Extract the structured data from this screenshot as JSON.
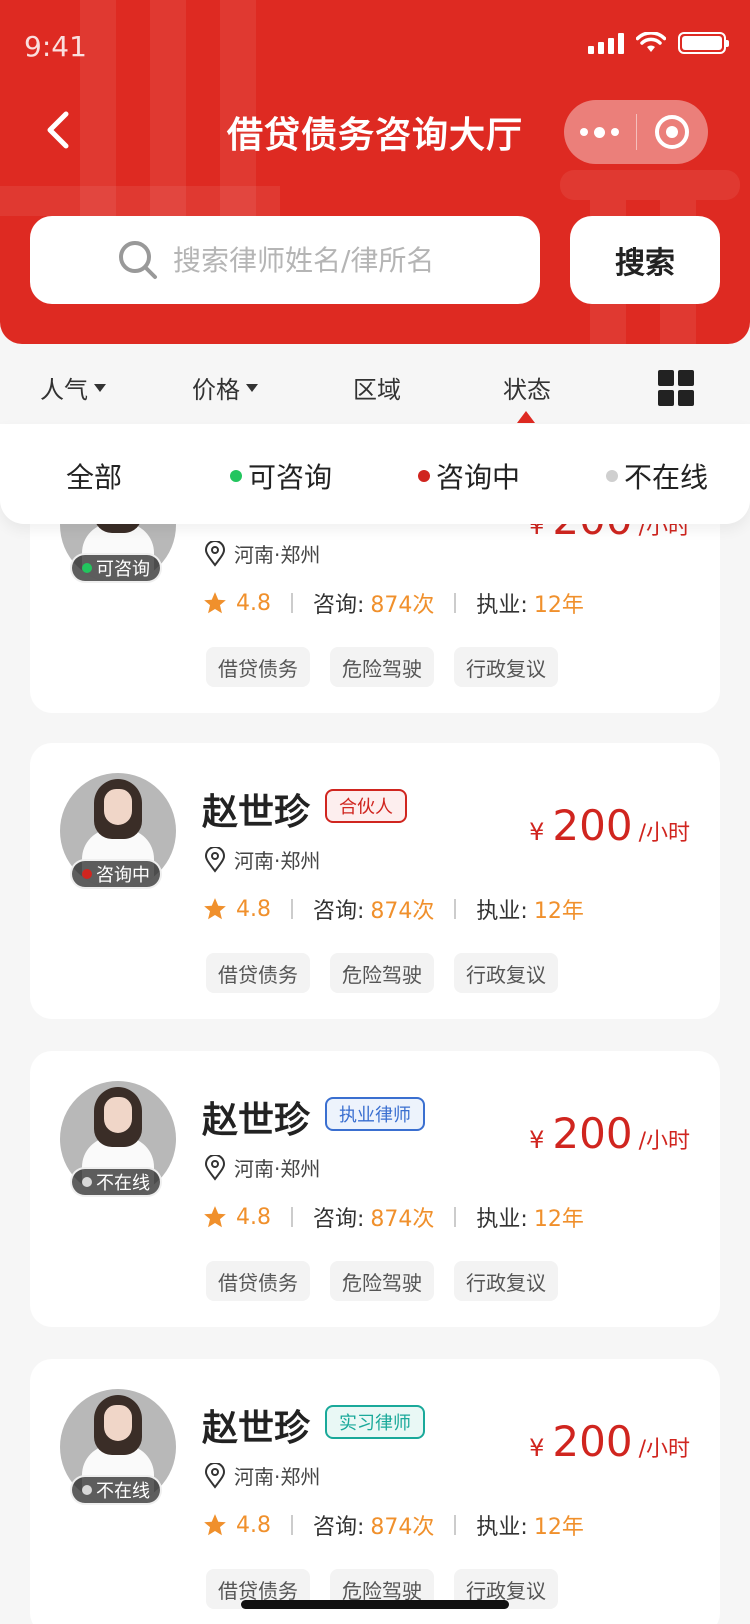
{
  "status_bar": {
    "time": "9:41"
  },
  "header": {
    "title": "借贷债务咨询大厅"
  },
  "search": {
    "placeholder": "搜索律师姓名/律所名",
    "button_label": "搜索"
  },
  "filters": [
    "人气",
    "价格",
    "区域",
    "状态"
  ],
  "status_options": [
    {
      "label": "全部",
      "dot_color": ""
    },
    {
      "label": "可咨询",
      "dot_color": "#22c55e"
    },
    {
      "label": "咨询中",
      "dot_color": "#d0251f"
    },
    {
      "label": "不在线",
      "dot_color": "#cfcfcf"
    }
  ],
  "cards": [
    {
      "name": "",
      "tag": "",
      "tag_color": "",
      "status": "可咨询",
      "status_color": "#22c55e",
      "location": "河南·郑州",
      "rating": "4.8",
      "consult_label": "咨询:",
      "consult_value": "874次",
      "practice_label": "执业:",
      "practice_value": "12年",
      "price_symbol": "¥",
      "price": "200",
      "price_unit": "/小时",
      "chips": [
        "借贷债务",
        "危险驾驶",
        "行政复议"
      ]
    },
    {
      "name": "赵世珍",
      "tag": "合伙人",
      "tag_color": "#d0251f",
      "status": "咨询中",
      "status_color": "#d0251f",
      "location": "河南·郑州",
      "rating": "4.8",
      "consult_label": "咨询:",
      "consult_value": "874次",
      "practice_label": "执业:",
      "practice_value": "12年",
      "price_symbol": "¥",
      "price": "200",
      "price_unit": "/小时",
      "chips": [
        "借贷债务",
        "危险驾驶",
        "行政复议"
      ]
    },
    {
      "name": "赵世珍",
      "tag": "执业律师",
      "tag_color": "#3a6fd0",
      "status": "不在线",
      "status_color": "#d8d8d8",
      "location": "河南·郑州",
      "rating": "4.8",
      "consult_label": "咨询:",
      "consult_value": "874次",
      "practice_label": "执业:",
      "practice_value": "12年",
      "price_symbol": "¥",
      "price": "200",
      "price_unit": "/小时",
      "chips": [
        "借贷债务",
        "危险驾驶",
        "行政复议"
      ]
    },
    {
      "name": "赵世珍",
      "tag": "实习律师",
      "tag_color": "#1aa99a",
      "status": "不在线",
      "status_color": "#d8d8d8",
      "location": "河南·郑州",
      "rating": "4.8",
      "consult_label": "咨询:",
      "consult_value": "874次",
      "practice_label": "执业:",
      "practice_value": "12年",
      "price_symbol": "¥",
      "price": "200",
      "price_unit": "/小时",
      "chips": [
        "借贷债务",
        "危险驾驶",
        "行政复议"
      ]
    }
  ],
  "colors": {
    "brand_red": "#de2a22",
    "price_red": "#d0251f",
    "accent_orange": "#f0902c"
  }
}
